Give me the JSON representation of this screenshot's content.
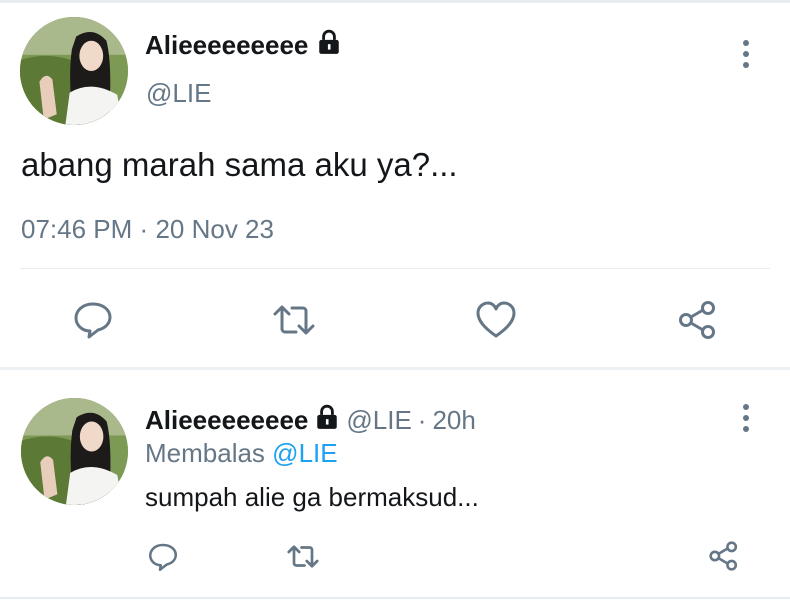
{
  "tweet": {
    "display_name": "Alieeeeeeeee",
    "handle": "@LIE",
    "text": "abang marah sama aku ya?...",
    "time": "07:46 PM",
    "separator": "·",
    "date": "20 Nov 23",
    "locked": true
  },
  "actions": [
    "reply-icon",
    "retweet-icon",
    "like-icon",
    "share-icon"
  ],
  "reply": {
    "display_name": "Alieeeeeeeee",
    "handle": "@LIE",
    "separator": "·",
    "age": "20h",
    "replying_prefix": "Membalas",
    "replying_to": "@LIE",
    "text": "sumpah alie ga bermaksud...",
    "locked": true
  },
  "colors": {
    "text": "#14171a",
    "secondary": "#657786",
    "link": "#1da1f2",
    "divider": "#e6ecf0"
  }
}
